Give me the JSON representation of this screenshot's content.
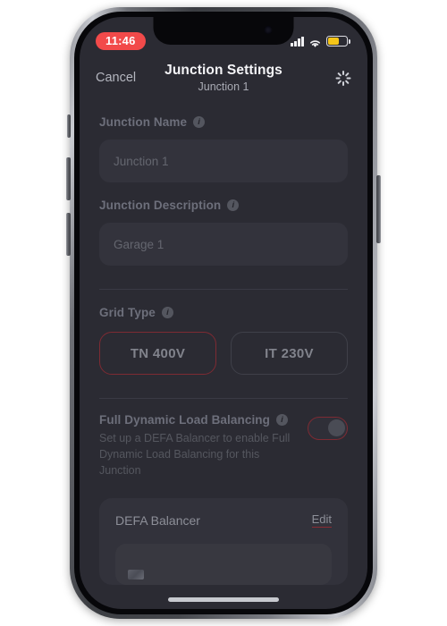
{
  "status_bar": {
    "time": "11:46",
    "time_pill_color": "#f24a4a",
    "signal_icon": "cellular-signal-icon",
    "wifi_icon": "wifi-icon",
    "battery_icon": "battery-low-power-icon",
    "battery_color": "#f5c518"
  },
  "nav": {
    "cancel_label": "Cancel",
    "title": "Junction Settings",
    "subtitle": "Junction 1",
    "spinner_icon": "loading-spinner-icon"
  },
  "form": {
    "junction_name": {
      "label": "Junction Name",
      "info_icon": "info-icon",
      "value": "Junction 1",
      "placeholder": "Junction 1"
    },
    "junction_description": {
      "label": "Junction Description",
      "info_icon": "info-icon",
      "value": "Garage 1",
      "placeholder": "Garage 1"
    },
    "grid_type": {
      "label": "Grid Type",
      "info_icon": "info-icon",
      "options": [
        {
          "label": "TN 400V",
          "selected": true
        },
        {
          "label": "IT 230V",
          "selected": false
        }
      ],
      "selected_border_color": "#7d2b33"
    },
    "load_balancing": {
      "label": "Full Dynamic Load Balancing",
      "info_icon": "info-icon",
      "description": "Set up a DEFA Balancer to enable Full Dynamic Load Balancing for this Junction",
      "toggle_state": "on",
      "toggle_accent_color": "#7d2b33"
    }
  },
  "balancer_card": {
    "title": "DEFA Balancer",
    "edit_label": "Edit",
    "edit_underline_color": "#8b2b33"
  },
  "accent": {
    "background": "#2b2b33",
    "field_background": "#33333c",
    "text_muted": "#6d6f7b"
  }
}
